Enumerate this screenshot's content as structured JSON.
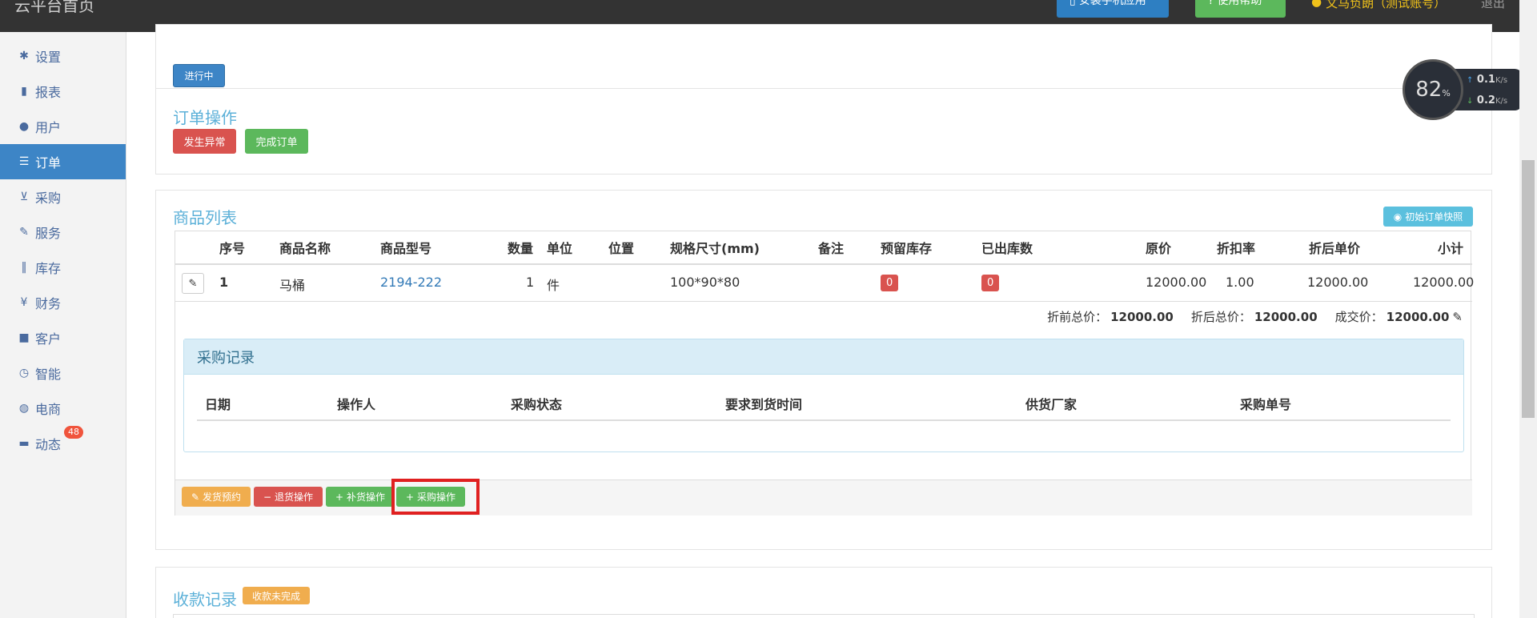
{
  "header": {
    "brand": "云平台首页",
    "install_app": "安装手机应用",
    "help": "使用帮助",
    "user": "文马负朗（测试账号）",
    "logout": "退出"
  },
  "sidebar": {
    "items": [
      {
        "label": "设置",
        "icon": "gear-icon"
      },
      {
        "label": "报表",
        "icon": "bar-chart-icon"
      },
      {
        "label": "用户",
        "icon": "user-icon"
      },
      {
        "label": "订单",
        "icon": "list-icon"
      },
      {
        "label": "采购",
        "icon": "cart-icon"
      },
      {
        "label": "服务",
        "icon": "wrench-icon"
      },
      {
        "label": "库存",
        "icon": "barcode-icon"
      },
      {
        "label": "财务",
        "icon": "yen-icon"
      },
      {
        "label": "客户",
        "icon": "briefcase-icon"
      },
      {
        "label": "智能",
        "icon": "dashboard-icon"
      },
      {
        "label": "电商",
        "icon": "globe-icon"
      },
      {
        "label": "动态",
        "icon": "comment-icon",
        "badge": "48"
      }
    ]
  },
  "status_button": "进行中",
  "order_ops": {
    "title": "订单操作",
    "exception": "发生异常",
    "complete": "完成订单"
  },
  "goods": {
    "title": "商品列表",
    "snapshot": "初始订单快照",
    "columns": [
      "序号",
      "商品名称",
      "商品型号",
      "数量",
      "单位",
      "位置",
      "规格尺寸(mm)",
      "备注",
      "预留库存",
      "已出库数",
      "原价",
      "折扣率",
      "折后单价",
      "小计"
    ],
    "rows": [
      {
        "no": "1",
        "name": "马桶",
        "model": "2194-222",
        "qty": "1",
        "unit": "件",
        "pos": "",
        "size": "100*90*80",
        "remark": "",
        "reserved": "0",
        "shipped": "0",
        "price": "12000.00",
        "discount": "1.00",
        "unit_after": "12000.00",
        "subtotal": "12000.00"
      }
    ],
    "totals": {
      "before_label": "折前总价：",
      "before": "12000.00",
      "after_label": "折后总价：",
      "after": "12000.00",
      "deal_label": "成交价：",
      "deal": "12000.00"
    }
  },
  "purchase": {
    "title": "采购记录",
    "columns": [
      "日期",
      "操作人",
      "采购状态",
      "要求到货时间",
      "供货厂家",
      "采购单号"
    ]
  },
  "actions": {
    "ship": "发货预约",
    "return": "退货操作",
    "restock": "补货操作",
    "purchase": "采购操作"
  },
  "payment": {
    "title": "收款记录",
    "badge": "收款未完成"
  },
  "netspeed": {
    "percent": "82",
    "percent_unit": "%",
    "up": "0.1",
    "down": "0.2",
    "unit": "K/s"
  }
}
